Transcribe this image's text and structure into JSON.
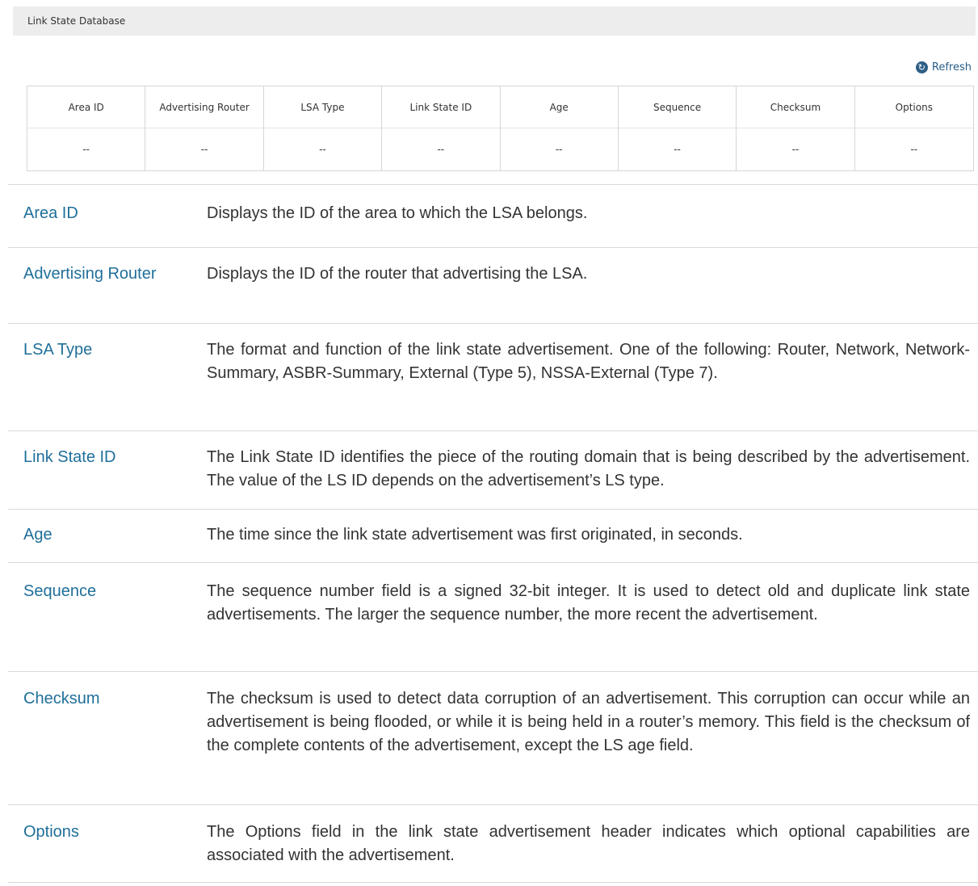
{
  "panel": {
    "title": "Link State Database",
    "refresh_label": "Refresh",
    "refresh_icon": "refresh-icon",
    "columns": [
      "Area ID",
      "Advertising Router",
      "LSA Type",
      "Link State ID",
      "Age",
      "Sequence",
      "Checksum",
      "Options"
    ],
    "row": [
      "--",
      "--",
      "--",
      "--",
      "--",
      "--",
      "--",
      "--"
    ]
  },
  "descriptions": [
    {
      "term": "Area ID",
      "text": "Displays the ID of the area to which the LSA belongs."
    },
    {
      "term": "Advertising Router",
      "text": "Displays the ID of the router that advertising the LSA."
    },
    {
      "term": "LSA Type",
      "text": "The format and function of the link state advertisement. One of the following: Router, Network, Network-Summary, ASBR-Summary, External (Type 5), NSSA-External (Type 7)."
    },
    {
      "term": "Link State ID",
      "text": "The Link State ID identifies the piece of the routing domain that is being described by the advertisement. The value of the LS ID depends on the advertisement’s LS type."
    },
    {
      "term": "Age",
      "text": "The time since the link state advertisement was first originated, in seconds."
    },
    {
      "term": "Sequence",
      "text": "The sequence number field is a signed 32-bit integer. It is used to detect old and duplicate link state advertisements. The larger the sequence number, the more recent the advertisement."
    },
    {
      "term": "Checksum",
      "text": "The checksum is used to detect data corruption of an advertisement. This corruption can occur while an advertisement is being flooded, or while it is being held in a router’s memory. This field is the checksum of the complete contents of the advertisement, except the LS age field."
    },
    {
      "term": "Options",
      "text": "The Options field in the link state advertisement header indicates which optional capabilities are associated with the advertisement."
    }
  ],
  "colors": {
    "term": "#1f6f9a",
    "accent": "#2f5f86",
    "header_bg": "#ededed"
  }
}
